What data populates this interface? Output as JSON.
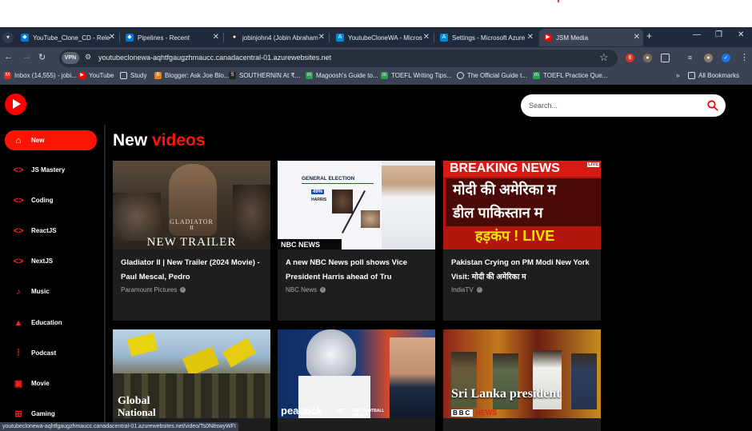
{
  "browser": {
    "tabs": [
      {
        "label": "YouTube_Clone_CD - Rele",
        "icon": "azure-devops-icon",
        "color": "#0078d4"
      },
      {
        "label": "Pipelines - Recent",
        "icon": "azure-devops-icon",
        "color": "#0078d4"
      },
      {
        "label": "jobinjohn4 (Jobin Abraham",
        "icon": "github-icon",
        "color": "#24292e"
      },
      {
        "label": "YoutubeCloneWA - Micros",
        "icon": "azure-icon",
        "color": "#0089d6"
      },
      {
        "label": "Settings - Microsoft Azure",
        "icon": "azure-icon",
        "color": "#0089d6"
      },
      {
        "label": "JSM Media",
        "icon": "youtube-icon",
        "color": "#ff0000"
      }
    ],
    "vpn_label": "VPN",
    "url": "youtubeclonewa-aqhtfgaugzhmaucc.canadacentral-01.azurewebsites.net",
    "extension_badge": "6",
    "bookmarks": [
      {
        "label": "Inbox (14,555) - jobi...",
        "icon": "gmail-icon",
        "color": "#d93025"
      },
      {
        "label": "YouTube",
        "icon": "youtube-icon",
        "color": "#ff0000"
      },
      {
        "label": "Study",
        "icon": "folder-icon",
        "color": "#3b4254"
      },
      {
        "label": "Blogger: Ask Joe Blo...",
        "icon": "blogger-icon",
        "color": "#f57d00"
      },
      {
        "label": "SOUTHERNIN At ₹...",
        "icon": "southernin-icon",
        "color": "#222222"
      },
      {
        "label": "Magoosh's Guide to...",
        "icon": "magoosh-icon",
        "color": "#2e9c57"
      },
      {
        "label": "TOEFL Writing Tips...",
        "icon": "magoosh-icon",
        "color": "#2e9c57"
      },
      {
        "label": "The Official Guide t...",
        "icon": "globe-icon",
        "color": "#3b4254"
      },
      {
        "label": "TOEFL Practice Que...",
        "icon": "magoosh-icon",
        "color": "#2e9c57"
      }
    ],
    "all_bookmarks": "All Bookmarks",
    "status_url": "youtubeclonewa-aqhtfgaugzhmaucc.canadacentral-01.azurewebsites.net/video/Ts0N8swyWFI"
  },
  "app": {
    "search_placeholder": "Search...",
    "heading_prefix": "New",
    "heading_accent": "videos",
    "accent_color": "#fc1503",
    "sidebar": [
      {
        "label": "New",
        "icon": "home-icon",
        "active": true
      },
      {
        "label": "JS Mastery",
        "icon": "code-icon"
      },
      {
        "label": "Coding",
        "icon": "code-icon"
      },
      {
        "label": "ReactJS",
        "icon": "code-icon"
      },
      {
        "label": "NextJS",
        "icon": "code-icon"
      },
      {
        "label": "Music",
        "icon": "music-note-icon"
      },
      {
        "label": "Education",
        "icon": "graduation-cap-icon"
      },
      {
        "label": "Podcast",
        "icon": "podcast-icon"
      },
      {
        "label": "Movie",
        "icon": "movie-icon"
      },
      {
        "label": "Gaming",
        "icon": "gaming-icon"
      }
    ],
    "videos": [
      {
        "title": "Gladiator II | New Trailer (2024 Movie) - Paul Mescal, Pedro",
        "channel": "Paramount Pictures",
        "thumb_lines": [
          "GLADIATOR",
          "II",
          "NEW TRAILER"
        ]
      },
      {
        "title": "A new NBC News poll shows Vice President Harris ahead of Tru",
        "channel": "NBC News",
        "thumb_lines": [
          "GENERAL ELECTION",
          "49%",
          "HARRIS",
          "NBC NEWS"
        ]
      },
      {
        "title": "Pakistan Crying on PM Modi New York Visit: मोदी की अमेरिका म",
        "channel": "IndiaTV",
        "thumb_lines": [
          "BREAKING NEWS",
          "मोदी की अमेरिका म",
          "डील पाकिस्तान म",
          "हड़कंप ! LIVE",
          "LIVE"
        ]
      },
      {
        "title": "",
        "channel": "",
        "thumb_lines": [
          "Global",
          "National"
        ]
      },
      {
        "title": "",
        "channel": "",
        "thumb_lines": [
          "peacock",
          "PFT",
          "PRO FOOTBALL TALK"
        ]
      },
      {
        "title": "",
        "channel": "",
        "thumb_lines": [
          "Sri Lanka president",
          "BBC",
          "NEWS"
        ]
      }
    ]
  }
}
